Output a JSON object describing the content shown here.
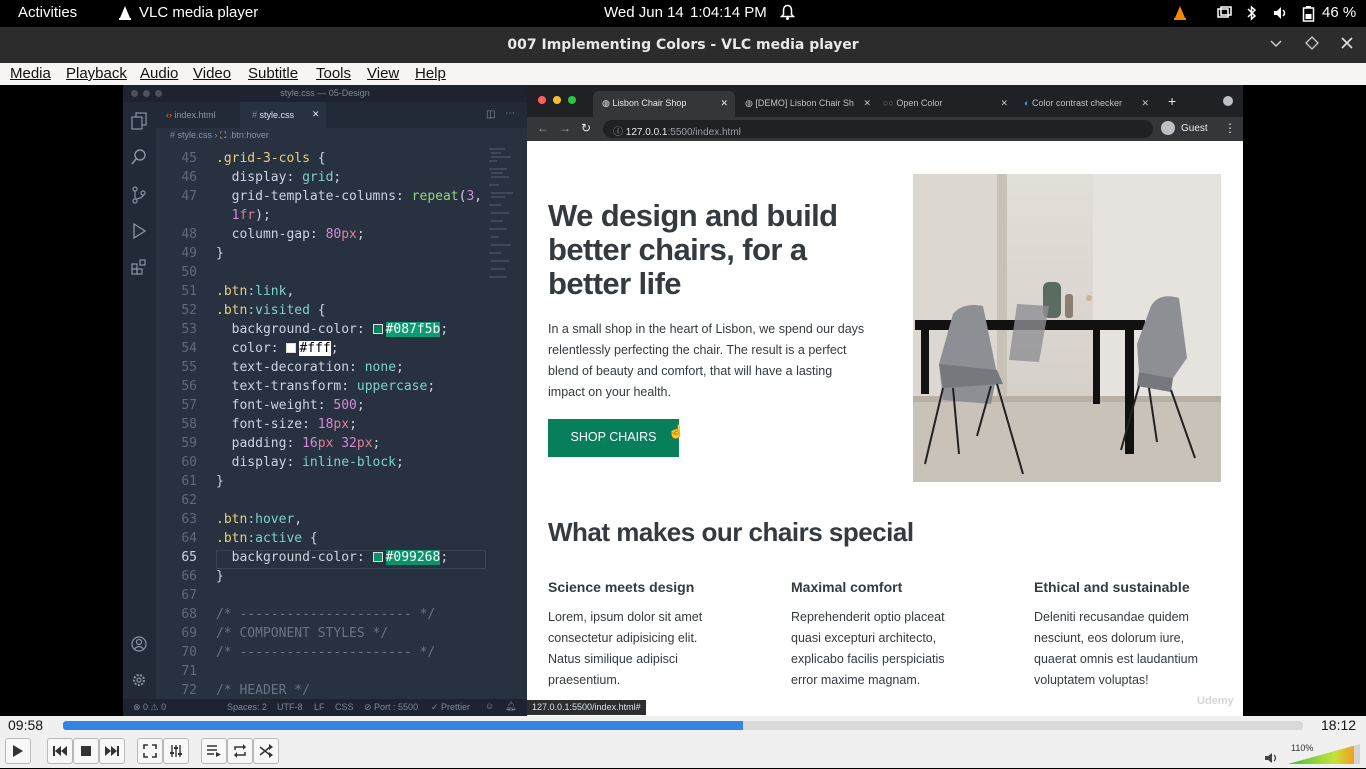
{
  "system_bar": {
    "activities": "Activities",
    "app_name": "VLC media player",
    "date": "Wed Jun 14",
    "time": "1:04:14 PM",
    "battery": "46 %"
  },
  "window": {
    "title": "007 Implementing Colors - VLC media player"
  },
  "menu": [
    "Media",
    "Playback",
    "Audio",
    "Video",
    "Subtitle",
    "Tools",
    "View",
    "Help"
  ],
  "editor": {
    "window_title": "style.css — 05-Design",
    "tabs": [
      "index.html",
      "style.css"
    ],
    "breadcrumb_file": "style.css",
    "breadcrumb_symbol": ".btn:hover",
    "lines": [
      {
        "n": "45",
        "t": ".grid-3-cols {"
      },
      {
        "n": "46",
        "t": "  display: grid;"
      },
      {
        "n": "47",
        "t": "  grid-template-columns: repeat(3,"
      },
      {
        "n": "",
        "t": "  1fr);"
      },
      {
        "n": "48",
        "t": "  column-gap: 80px;"
      },
      {
        "n": "49",
        "t": "}"
      },
      {
        "n": "50",
        "t": ""
      },
      {
        "n": "51",
        "t": ".btn:link,"
      },
      {
        "n": "52",
        "t": ".btn:visited {"
      },
      {
        "n": "53",
        "t": "  background-color: #087f5b;"
      },
      {
        "n": "54",
        "t": "  color: #fff;"
      },
      {
        "n": "55",
        "t": "  text-decoration: none;"
      },
      {
        "n": "56",
        "t": "  text-transform: uppercase;"
      },
      {
        "n": "57",
        "t": "  font-weight: 500;"
      },
      {
        "n": "58",
        "t": "  font-size: 18px;"
      },
      {
        "n": "59",
        "t": "  padding: 16px 32px;"
      },
      {
        "n": "60",
        "t": "  display: inline-block;"
      },
      {
        "n": "61",
        "t": "}"
      },
      {
        "n": "62",
        "t": ""
      },
      {
        "n": "63",
        "t": ".btn:hover,"
      },
      {
        "n": "64",
        "t": ".btn:active {"
      },
      {
        "n": "65",
        "t": "  background-color: #099268;"
      },
      {
        "n": "66",
        "t": "}"
      },
      {
        "n": "67",
        "t": ""
      },
      {
        "n": "68",
        "t": "/* ---------------------- */"
      },
      {
        "n": "69",
        "t": "/* COMPONENT STYLES */"
      },
      {
        "n": "70",
        "t": "/* ---------------------- */"
      },
      {
        "n": "71",
        "t": ""
      },
      {
        "n": "72",
        "t": "/* HEADER */"
      }
    ],
    "status": {
      "problems": "⊗ 0 ⚠ 0",
      "spaces": "Spaces: 2",
      "encoding": "UTF-8",
      "eol": "LF",
      "language": "CSS",
      "port": "⊘ Port : 5500",
      "prettier": "✓ Prettier"
    }
  },
  "browser": {
    "tabs": [
      "Lisbon Chair Shop",
      "[DEMO] Lisbon Chair Sh",
      "Open Color",
      "Color contrast checker"
    ],
    "url_host": "127.0.0.1",
    "url_path": ":5500/index.html",
    "profile": "Guest",
    "status_url": "127.0.0.1:5500/index.html#",
    "watermark": "Udemy"
  },
  "page": {
    "hero_title": "We design and build better chairs, for a better life",
    "hero_text": "In a small shop in the heart of Lisbon, we spend our days relentlessly perfecting the chair. The result is a perfect blend of beauty and comfort, that will have a lasting impact on your health.",
    "cta": "SHOP CHAIRS",
    "section_title": "What makes our chairs special",
    "features": [
      {
        "title": "Science meets design",
        "text": "Lorem, ipsum dolor sit amet consectetur adipisicing elit. Natus similique adipisci praesentium."
      },
      {
        "title": "Maximal comfort",
        "text": "Reprehenderit optio placeat quasi excepturi architecto, explicabo facilis perspiciatis error maxime magnam."
      },
      {
        "title": "Ethical and sustainable",
        "text": "Deleniti recusandae quidem nesciunt, eos dolorum iure, quaerat omnis est laudantium voluptatem voluptas!"
      }
    ]
  },
  "player": {
    "elapsed": "09:58",
    "total": "18:12",
    "progress": 0.548,
    "volume": "110%"
  },
  "colors": {
    "accent_green": "#087f5b",
    "progress_blue": "#3584e4"
  }
}
